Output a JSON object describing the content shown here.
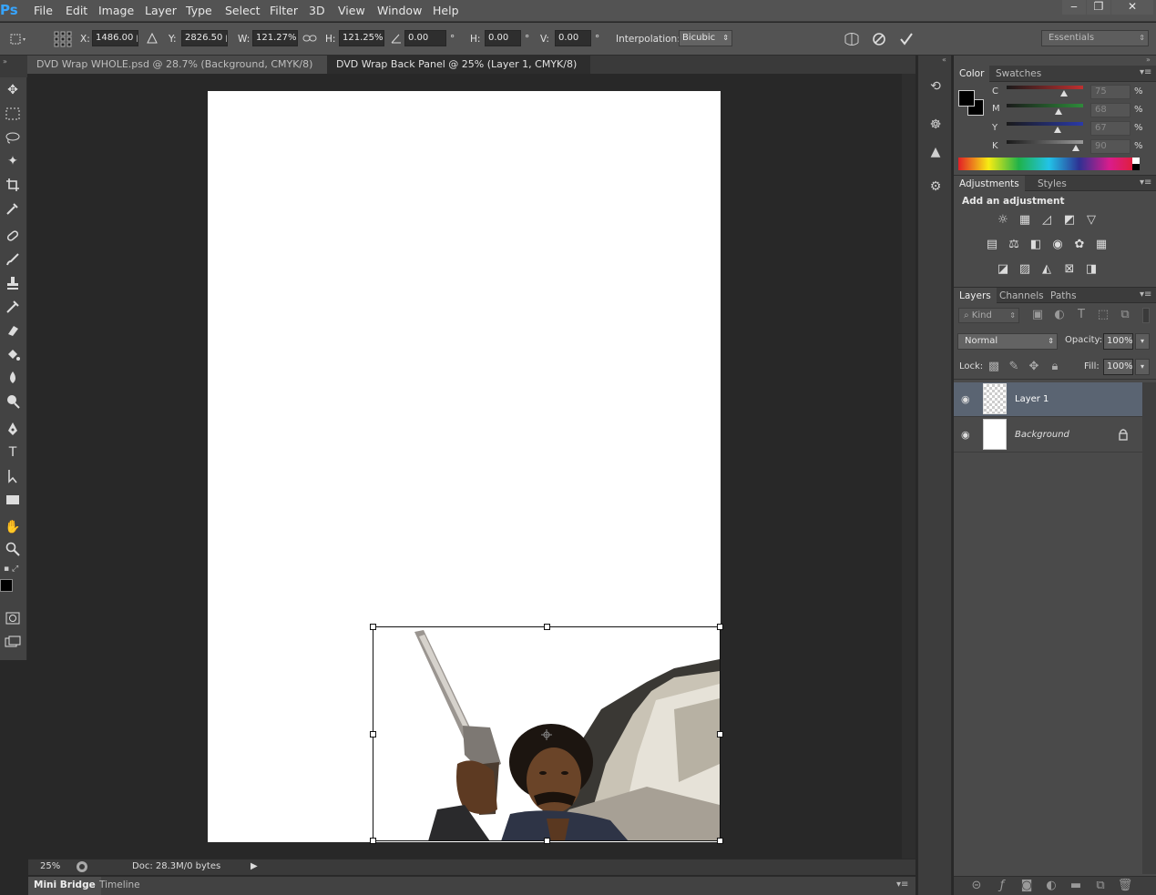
{
  "app": {
    "logo": "Ps"
  },
  "menu": [
    "File",
    "Edit",
    "Image",
    "Layer",
    "Type",
    "Select",
    "Filter",
    "3D",
    "View",
    "Window",
    "Help"
  ],
  "window_controls": {
    "minimize": "‒",
    "restore": "❐",
    "close": "✕"
  },
  "options": {
    "x_label": "X:",
    "x_value": "1486.00 p",
    "y_label": "Y:",
    "y_value": "2826.50 p",
    "w_label": "W:",
    "w_value": "121.27%",
    "h_label": "H:",
    "h_value": "121.25%",
    "angle_value": "0.00",
    "angle_unit": "°",
    "skew_h_label": "H:",
    "skew_h_value": "0.00",
    "skew_h_unit": "°",
    "skew_v_label": "V:",
    "skew_v_value": "0.00",
    "skew_v_unit": "°",
    "interpolation_label": "Interpolation:",
    "interpolation_value": "Bicubic",
    "workspace": "Essentials"
  },
  "tabs": [
    {
      "label": "DVD Wrap WHOLE.psd @ 28.7% (Background, CMYK/8) *",
      "active": false
    },
    {
      "label": "DVD Wrap Back Panel @ 25% (Layer 1, CMYK/8) *",
      "active": true
    }
  ],
  "tab_close": "×",
  "status": {
    "zoom": "25%",
    "doc": "Doc: 28.3M/0 bytes"
  },
  "bottom_tabs": [
    "Mini Bridge",
    "Timeline"
  ],
  "color_panel": {
    "tabs": [
      "Color",
      "Swatches"
    ],
    "channels": [
      {
        "label": "C",
        "value": "75",
        "pct": 75,
        "color": "#c03030"
      },
      {
        "label": "M",
        "value": "68",
        "pct": 68,
        "color": "#2e8a3a"
      },
      {
        "label": "Y",
        "value": "67",
        "pct": 67,
        "color": "#2a3aa8"
      },
      {
        "label": "K",
        "value": "90",
        "pct": 90,
        "color": "#999999"
      }
    ],
    "unit": "%"
  },
  "adjustments_panel": {
    "tabs": [
      "Adjustments",
      "Styles"
    ],
    "heading": "Add an adjustment"
  },
  "layers_panel": {
    "tabs": [
      "Layers",
      "Channels",
      "Paths"
    ],
    "filter_kind": "Kind",
    "blend_mode": "Normal",
    "opacity_label": "Opacity:",
    "opacity_value": "100%",
    "lock_label": "Lock:",
    "fill_label": "Fill:",
    "fill_value": "100%",
    "layers": [
      {
        "name": "Layer 1",
        "selected": true
      },
      {
        "name": "Background",
        "selected": false
      }
    ]
  }
}
